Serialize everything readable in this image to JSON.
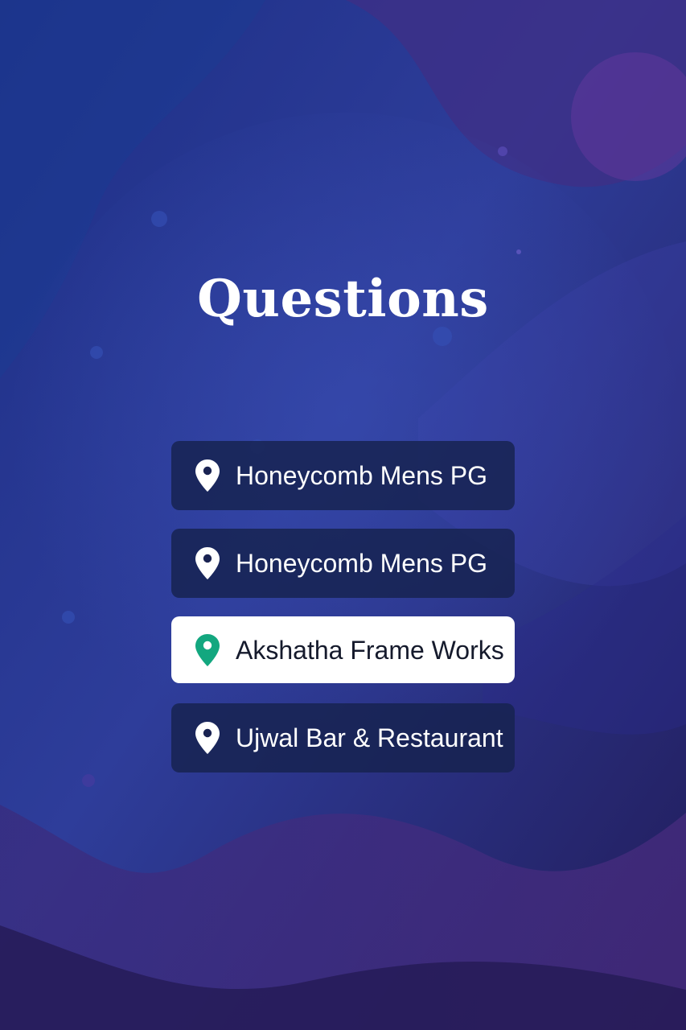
{
  "page": {
    "title": "Questions"
  },
  "options": [
    {
      "label": "Honeycomb Mens PG",
      "icon": "location-pin-icon",
      "selected": false
    },
    {
      "label": "Honeycomb Mens PG",
      "icon": "location-pin-icon",
      "selected": false
    },
    {
      "label": "Akshatha Frame Works",
      "icon": "location-pin-icon",
      "selected": true
    },
    {
      "label": "Ujwal Bar & Restaurant",
      "icon": "location-pin-icon",
      "selected": false
    }
  ],
  "colors": {
    "background_top": "#1c2f82",
    "background_bottom": "#2a1f5c",
    "option_background": "#16224e",
    "selected_background": "#ffffff",
    "selected_pin": "#13a77f",
    "pin": "#ffffff"
  }
}
